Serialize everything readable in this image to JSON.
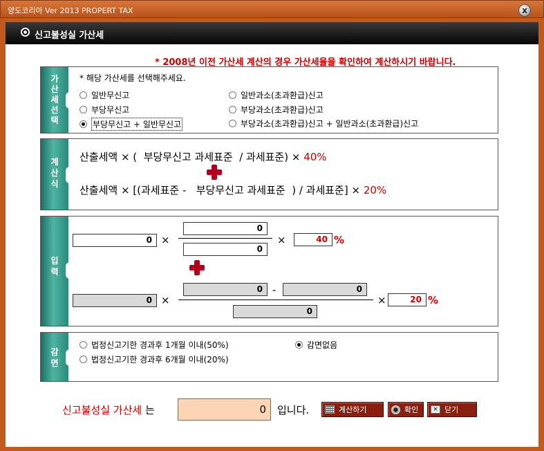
{
  "window": {
    "title": "양도코리아 Ver 2013  PROPERT  TAX",
    "close": "x"
  },
  "header": {
    "title": "신고불성실 가산세"
  },
  "notice": "* 2008년 이전 가산세 계산의 경우 가산세율을 확인하여 계산하시기 바랍니다.",
  "select_panel": {
    "tab": [
      "가",
      "산",
      "세",
      "선",
      "택"
    ],
    "instruction": "* 해당 가산세를 선택해주세요.",
    "options": [
      {
        "label": "일반무신고",
        "selected": false
      },
      {
        "label": "일반과소(초과환급)신고",
        "selected": false
      },
      {
        "label": "부당무신고",
        "selected": false
      },
      {
        "label": "부당과소(초과환급)신고",
        "selected": false
      },
      {
        "label": "부당무신고 + 일반무신고",
        "selected": true
      },
      {
        "label": "부당과소(초과환급)신고 + 일반과소(초과환급)신고",
        "selected": false
      }
    ]
  },
  "formula_panel": {
    "tab": [
      "계",
      "산",
      "식"
    ],
    "line1": "산출세액 × (  부당무신고 과세표준  / 과세표준) × ",
    "line1_rate": "40%",
    "line2": "산출세액 × [(과세표준 -   부당무신고 과세표준  ) / 과세표준] × ",
    "line2_rate": "20%"
  },
  "input_panel": {
    "tab": [
      "입",
      "력"
    ],
    "row1": {
      "base": "0",
      "numerator": "0",
      "denominator": "0",
      "rate": "40",
      "unit": "%"
    },
    "row2": {
      "base": "0",
      "minuend": "0",
      "subtrahend": "0",
      "denominator": "0",
      "rate": "20",
      "unit": "%"
    },
    "times": "×",
    "minus": "-"
  },
  "reduction_panel": {
    "tab": [
      "감",
      "면"
    ],
    "options": [
      {
        "label": "법정신고기한 경과후 1개월 이내(50%)",
        "selected": false
      },
      {
        "label": "감면없음",
        "selected": true
      },
      {
        "label": "법정신고기한 경과후 6개월 이내(20%)",
        "selected": false
      }
    ]
  },
  "footer": {
    "label_main": "신고불성실 가산세",
    "label_suffix": " 는",
    "result": "0",
    "ipnida": "입니다.",
    "calc_button": "계산하기",
    "ok_button": "확인",
    "close_button": "닫기"
  },
  "colors": {
    "accent_red": "#cc0000",
    "frame": "#c35a1d",
    "tab_teal": "#2a8a7b",
    "button": "#8a1f0f"
  }
}
